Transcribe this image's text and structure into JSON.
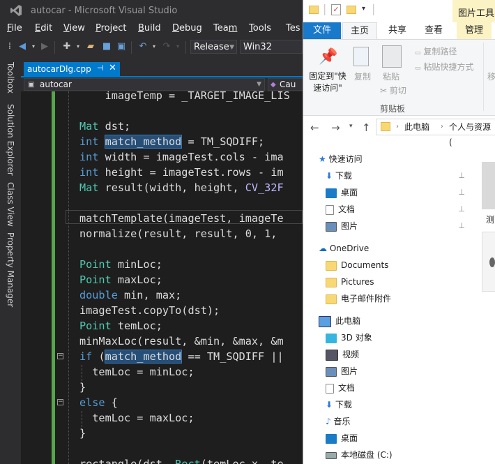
{
  "vs": {
    "window_title": "autocar - Microsoft Visual Studio",
    "menu": [
      {
        "label": "File",
        "mnemonic": "F",
        "rest": "ile"
      },
      {
        "label": "Edit",
        "mnemonic": "E",
        "rest": "dit"
      },
      {
        "label": "View",
        "mnemonic": "V",
        "rest": "iew"
      },
      {
        "label": "Project",
        "mnemonic": "P",
        "rest": "roject"
      },
      {
        "label": "Build",
        "mnemonic": "B",
        "rest": "uild"
      },
      {
        "label": "Debug",
        "mnemonic": "D",
        "rest": "ebug"
      },
      {
        "label": "Team",
        "pre": "Tea",
        "mnemonic": "m",
        "rest": ""
      },
      {
        "label": "Tools",
        "mnemonic": "T",
        "rest": "ools"
      },
      {
        "label": "Test",
        "mnemonic": "",
        "rest": "Tes"
      }
    ],
    "toolbar": {
      "configuration": "Release",
      "platform": "Win32"
    },
    "side_tabs": [
      "Toolbox",
      "Solution Explorer",
      "Class View",
      "Property Manager"
    ],
    "doc_tab": "autocarDlg.cpp",
    "nav_scope": "autocar",
    "nav_member": "Cau",
    "code_lines": [
      "    imageTemp = _TARGET_IMAGE_LIS",
      "",
      "Mat dst;",
      "int match_method = TM_SQDIFF;",
      "int width = imageTest.cols - ima",
      "int height = imageTest.rows - im",
      "Mat result(width, height, CV_32F",
      "",
      "matchTemplate(imageTest, imageTe",
      "normalize(result, result, 0, 1,",
      "",
      "Point minLoc;",
      "Point maxLoc;",
      "double min, max;",
      "imageTest.copyTo(dst);",
      "Point temLoc;",
      "minMaxLoc(result, &min, &max, &m",
      "if (match_method == TM_SQDIFF ||",
      "  temLoc = minLoc;",
      "}",
      "else {",
      "  temLoc = maxLoc;",
      "}",
      "",
      "rectangle(dst, Rect(temLoc.x, te"
    ]
  },
  "explorer": {
    "contextual_tab_group": "图片工具",
    "ribbon_tabs": [
      "文件",
      "主页",
      "共享",
      "查看",
      "管理"
    ],
    "ribbon_buttons": {
      "pin": "固定到\"快速访问\"",
      "copy": "复制",
      "paste": "粘贴",
      "copy_path": "复制路径",
      "paste_shortcut": "粘贴快捷方式",
      "cut": "剪切",
      "move": "移",
      "group_clipboard": "剪贴板"
    },
    "breadcrumb": [
      "此电脑",
      "个人与资源 ("
    ],
    "quick_access": {
      "label": "快速访问",
      "items": [
        "下载",
        "桌面",
        "文档",
        "图片"
      ]
    },
    "onedrive": {
      "label": "OneDrive",
      "items": [
        "Documents",
        "Pictures",
        "电子邮件附件"
      ]
    },
    "this_pc": {
      "label": "此电脑",
      "items": [
        "3D 对象",
        "视频",
        "图片",
        "文档",
        "下载",
        "音乐",
        "桌面",
        "本地磁盘 (C:)"
      ]
    },
    "content_label": "测"
  }
}
